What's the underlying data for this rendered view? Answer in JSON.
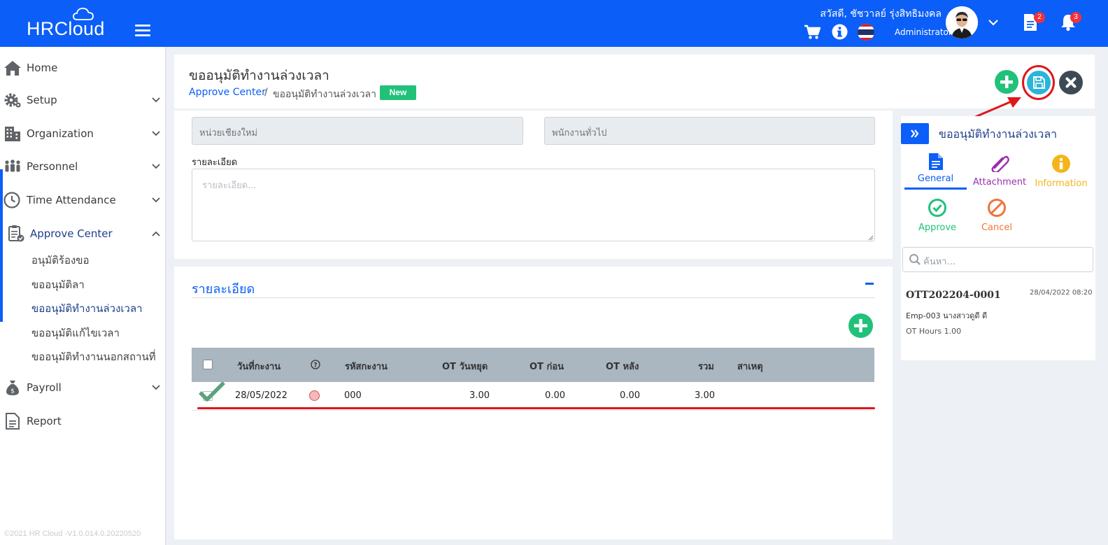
{
  "app": {
    "logo_text": "HRCloud",
    "greeting": "สวัสดี, ชัชวาลย์ รุ่งสิทธิมงคล",
    "role": "Administrator",
    "badges": {
      "documents": "2",
      "notifications": "3"
    },
    "brand_color": "#0b5ef7"
  },
  "sidebar": {
    "items": [
      {
        "label": "Home",
        "icon": "home-icon"
      },
      {
        "label": "Setup",
        "icon": "gear-icon"
      },
      {
        "label": "Organization",
        "icon": "building-icon"
      },
      {
        "label": "Personnel",
        "icon": "people-icon"
      },
      {
        "label": "Time Attendance",
        "icon": "clock-icon"
      },
      {
        "label": "Approve Center",
        "icon": "clipboard-check-icon"
      },
      {
        "label": "Payroll",
        "icon": "money-bag-icon"
      },
      {
        "label": "Report",
        "icon": "report-icon"
      }
    ],
    "sub_items": [
      {
        "label": "อนุมัติร้องขอ"
      },
      {
        "label": "ขออนุมัติลา"
      },
      {
        "label": "ขออนุมัติทำงานล่วงเวลา"
      },
      {
        "label": "ขออนุมัติแก้ไขเวลา"
      },
      {
        "label": "ขออนุมัติทำงานนอกสถานที่"
      }
    ],
    "footer": "©2021 HR Cloud -V1.0.014.0.20220520"
  },
  "header": {
    "title": "ขออนุมัติทำงานล่วงเวลา",
    "breadcrumb_link": "Approve Center",
    "breadcrumb_sep": "/",
    "breadcrumb_current": "ขออนุมัติทำงานล่วงเวลา",
    "status_badge": "New"
  },
  "form": {
    "unit_value": "หน่วยเชียงใหม่",
    "position_value": "พนักงานทั่วไป",
    "detail_label": "รายละเอียด",
    "detail_placeholder": "รายละเอียด..."
  },
  "detail": {
    "section_title": "รายละเอียด",
    "columns": [
      "วันที่กะงาน",
      "?",
      "รหัสกะงาน",
      "OT วันหยุด",
      "OT ก่อน",
      "OT หลัง",
      "รวม",
      "สาเหตุ"
    ],
    "rows": [
      {
        "date": "28/05/2022",
        "shift_code": "000",
        "ot_holiday": "3.00",
        "ot_before": "0.00",
        "ot_after": "0.00",
        "total": "3.00",
        "reason": "",
        "status_color": "#f4b8bd"
      }
    ]
  },
  "right_panel": {
    "title": "ขออนุมัติทำงานล่วงเวลา",
    "tabs": [
      {
        "label": "General",
        "color": "#0b5ef7"
      },
      {
        "label": "Attachment",
        "color": "#9b2fae"
      },
      {
        "label": "Information",
        "color": "#f3b51b"
      },
      {
        "label": "Approve",
        "color": "#21c17a"
      },
      {
        "label": "Cancel",
        "color": "#f0743a"
      }
    ],
    "search_placeholder": "ค้นหา...",
    "record": {
      "id": "OTT202204-0001",
      "datetime": "28/04/2022 08:20",
      "employee": "Emp-003 นางสาวดูดี ดี",
      "ot_hours": "OT Hours 1.00"
    }
  }
}
